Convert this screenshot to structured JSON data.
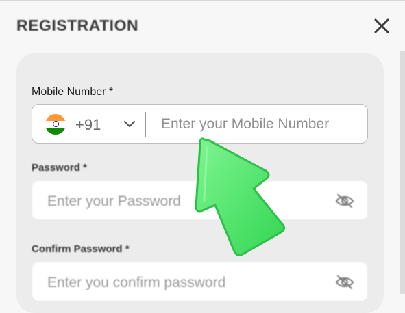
{
  "header": {
    "title": "REGISTRATION"
  },
  "form": {
    "mobile": {
      "label": "Mobile Number *",
      "country_code": "+91",
      "placeholder": "Enter your Mobile Number",
      "flag_icon": "india-flag-icon"
    },
    "password": {
      "label": "Password *",
      "placeholder": "Enter your Password"
    },
    "confirm_password": {
      "label": "Confirm Password *",
      "placeholder": "Enter you confirm password"
    }
  },
  "colors": {
    "arrow": "#4ee76a",
    "background": "#f7f7f7",
    "card": "#ececec"
  }
}
